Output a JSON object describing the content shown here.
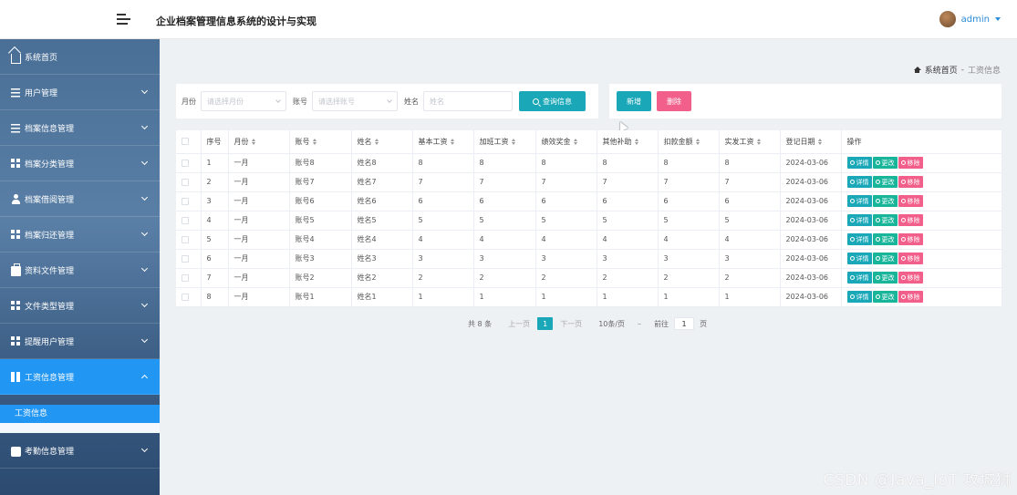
{
  "header": {
    "title": "企业档案管理信息系统的设计与实现",
    "username": "admin"
  },
  "sidebar": {
    "items": [
      {
        "label": "系统首页",
        "icon": "home-icon"
      },
      {
        "label": "用户管理",
        "icon": "sliders-icon"
      },
      {
        "label": "档案信息管理",
        "icon": "list-icon"
      },
      {
        "label": "档案分类管理",
        "icon": "grid-icon"
      },
      {
        "label": "档案借阅管理",
        "icon": "person-icon"
      },
      {
        "label": "档案归还管理",
        "icon": "grid-icon"
      },
      {
        "label": "资料文件管理",
        "icon": "briefcase-icon"
      },
      {
        "label": "文件类型管理",
        "icon": "grid-icon"
      },
      {
        "label": "提醒用户管理",
        "icon": "grid-icon"
      },
      {
        "label": "工资信息管理",
        "icon": "book-icon"
      },
      {
        "label": "考勤信息管理",
        "icon": "printer-icon"
      }
    ],
    "submenu_item": "工资信息"
  },
  "breadcrumb": {
    "root": "系统首页",
    "separator": "-",
    "current": "工资信息"
  },
  "search": {
    "month_label": "月份",
    "month_placeholder": "请选择月份",
    "account_label": "账号",
    "account_placeholder": "请选择账号",
    "name_label": "姓名",
    "name_placeholder": "姓名",
    "query_button": "查询信息"
  },
  "actions": {
    "add_button": "新增",
    "delete_button": "删除"
  },
  "table": {
    "headers": [
      "序号",
      "月份",
      "账号",
      "姓名",
      "基本工资",
      "加班工资",
      "绩效奖金",
      "其他补助",
      "扣款金额",
      "实发工资",
      "登记日期",
      "操作"
    ],
    "rows": [
      [
        "1",
        "一月",
        "账号8",
        "姓名8",
        "8",
        "8",
        "8",
        "8",
        "8",
        "8",
        "2024-03-06"
      ],
      [
        "2",
        "一月",
        "账号7",
        "姓名7",
        "7",
        "7",
        "7",
        "7",
        "7",
        "7",
        "2024-03-06"
      ],
      [
        "3",
        "一月",
        "账号6",
        "姓名6",
        "6",
        "6",
        "6",
        "6",
        "6",
        "6",
        "2024-03-06"
      ],
      [
        "4",
        "一月",
        "账号5",
        "姓名5",
        "5",
        "5",
        "5",
        "5",
        "5",
        "5",
        "2024-03-06"
      ],
      [
        "5",
        "一月",
        "账号4",
        "姓名4",
        "4",
        "4",
        "4",
        "4",
        "4",
        "4",
        "2024-03-06"
      ],
      [
        "6",
        "一月",
        "账号3",
        "姓名3",
        "3",
        "3",
        "3",
        "3",
        "3",
        "3",
        "2024-03-06"
      ],
      [
        "7",
        "一月",
        "账号2",
        "姓名2",
        "2",
        "2",
        "2",
        "2",
        "2",
        "2",
        "2024-03-06"
      ],
      [
        "8",
        "一月",
        "账号1",
        "姓名1",
        "1",
        "1",
        "1",
        "1",
        "1",
        "1",
        "2024-03-06"
      ]
    ],
    "op_labels": {
      "detail": "详情",
      "edit": "更改",
      "remove": "移除"
    }
  },
  "pagination": {
    "total": "共 8 条",
    "prev": "上一页",
    "current": "1",
    "next": "下一页",
    "page_size": "10条/页",
    "goto_label": "前往",
    "goto_value": "1",
    "page_label": "页"
  },
  "watermark": "CSDN @Java_IoT 攻城狮",
  "colors": {
    "accent": "#1aa8b8",
    "danger": "#f25f8a",
    "edit": "#19b59a",
    "active_menu": "#2196f3"
  }
}
